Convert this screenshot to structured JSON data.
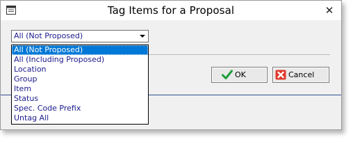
{
  "window": {
    "title": "Tag Items for a Proposal",
    "close_glyph": "✕",
    "app_icon": "window-icon",
    "close_icon": "close-icon"
  },
  "combo": {
    "value": "All (Not Proposed)",
    "arrow_icon": "dropdown-arrow-icon"
  },
  "dropdown": {
    "selected_index": 0,
    "options": [
      "All (Not Proposed)",
      "All (Including Proposed)",
      "Location",
      "Group",
      "Item",
      "Status",
      "Spec. Code Prefix",
      "Untag All"
    ]
  },
  "buttons": {
    "ok_label": "OK",
    "ok_icon": "checkmark-icon",
    "cancel_label": "Cancel",
    "cancel_icon": "cancel-x-icon"
  },
  "colors": {
    "selection": "#0078d7",
    "option_text": "#1a1a8c",
    "ok_check": "#1e9e3a",
    "cancel_x": "#d9261c",
    "footer_line": "#2f4f8f"
  }
}
